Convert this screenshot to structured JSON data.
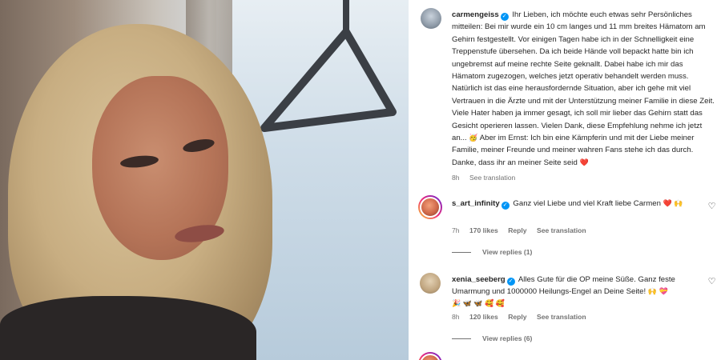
{
  "post": {
    "username": "carmengeiss",
    "caption": "Ihr Lieben, ich möchte euch etwas sehr Persönliches mitteilen: Bei mir wurde ein 10 cm langes und 11 mm breites Hämatom am Gehirn festgestellt. Vor einigen Tagen habe ich in der Schnelligkeit eine Treppenstufe übersehen. Da ich beide Hände voll bepackt hatte bin ich ungebremst auf meine rechte Seite geknallt. Dabei habe ich mir das Hämatom zugezogen, welches jetzt operativ behandelt werden muss. Natürlich ist das eine herausfordernde Situation, aber ich gehe mit viel Vertrauen in die Ärzte und mit der Unterstützung meiner Familie in diese Zeit. Viele Hater haben ja immer gesagt, ich soll mir lieber das Gehirn statt das Gesicht operieren lassen. Vielen Dank, diese Empfehlung nehme ich jetzt an...",
    "caption_emoji_1": "🥳",
    "caption_end": "Aber im Ernst: Ich bin eine Kämpferin und mit der Liebe meiner Familie, meiner Freunde und meiner wahren Fans stehe ich das durch. Danke, dass ihr an meiner Seite seid",
    "caption_heart": "❤️",
    "time": "8h",
    "see_translation": "See translation"
  },
  "comments": [
    {
      "username": "s_art_infinity",
      "text": "Ganz viel Liebe und viel Kraft liebe Carmen",
      "emoji": "❤️ 🙌",
      "time": "7h",
      "likes": "170 likes",
      "reply": "Reply",
      "see_translation": "See translation",
      "view_replies": "View replies (1)"
    },
    {
      "username": "xenia_seeberg",
      "text": "Alles Gute für die OP meine Süße. Ganz feste Umarmung und 1000000 Heilungs-Engel an Deine Seite!",
      "emoji": "🙌 💝",
      "emoji_line2": "🎉 🦋 🦋 🥰 🥰",
      "time": "8h",
      "likes": "120 likes",
      "reply": "Reply",
      "see_translation": "See translation",
      "view_replies": "View replies (6)"
    }
  ],
  "icons": {
    "verified": "verified-badge-icon",
    "like": "heart-outline-icon"
  },
  "colors": {
    "verified": "#0095f6",
    "secondary_text": "#737373",
    "heart": "#ff3040"
  }
}
